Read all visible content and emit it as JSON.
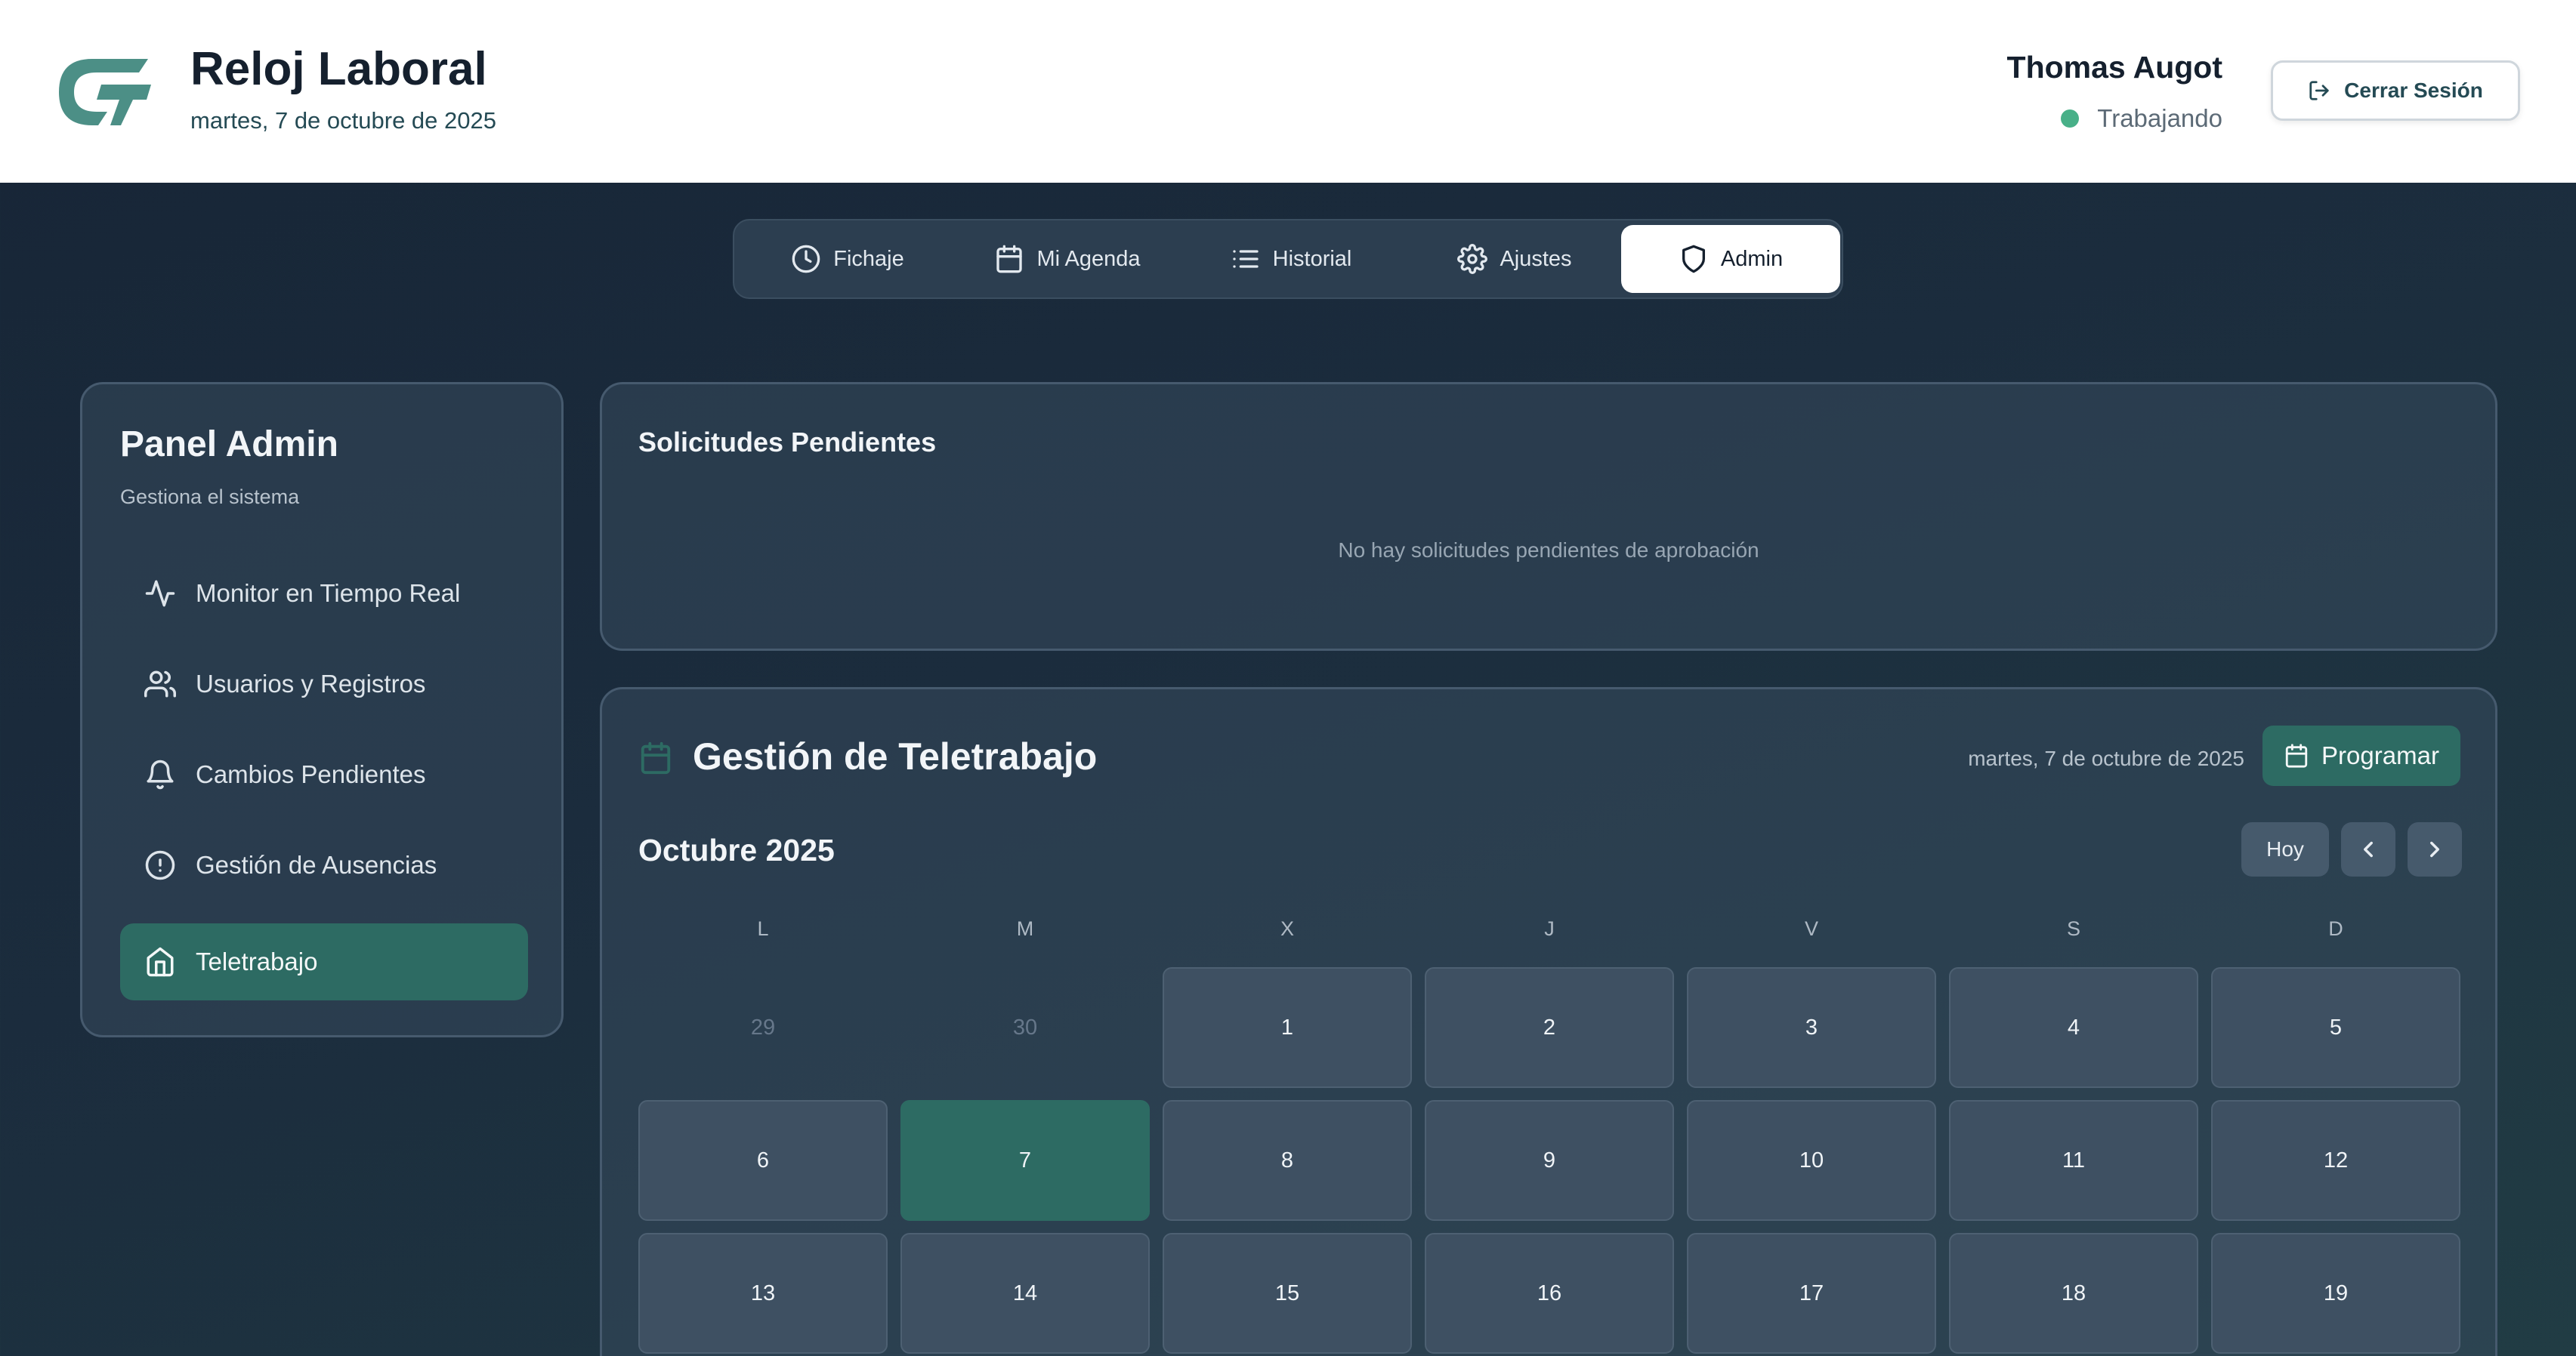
{
  "header": {
    "title": "Reloj Laboral",
    "date": "martes, 7 de octubre de 2025",
    "user_name": "Thomas Augot",
    "user_status": "Trabajando",
    "logout_label": "Cerrar Sesión"
  },
  "tabs": [
    {
      "label": "Fichaje",
      "icon": "clock-icon"
    },
    {
      "label": "Mi Agenda",
      "icon": "calendar-icon"
    },
    {
      "label": "Historial",
      "icon": "list-icon"
    },
    {
      "label": "Ajustes",
      "icon": "gear-icon"
    },
    {
      "label": "Admin",
      "icon": "shield-icon",
      "active": true
    }
  ],
  "sidebar": {
    "title": "Panel Admin",
    "subtitle": "Gestiona el sistema",
    "items": [
      {
        "label": "Monitor en Tiempo Real",
        "icon": "activity-icon"
      },
      {
        "label": "Usuarios y Registros",
        "icon": "users-icon"
      },
      {
        "label": "Cambios Pendientes",
        "icon": "bell-icon"
      },
      {
        "label": "Gestión de Ausencias",
        "icon": "alert-circle-icon"
      },
      {
        "label": "Teletrabajo",
        "icon": "home-icon",
        "active": true
      }
    ]
  },
  "requests": {
    "title": "Solicitudes Pendientes",
    "empty_message": "No hay solicitudes pendientes de aprobación"
  },
  "telework": {
    "title": "Gestión de Teletrabajo",
    "date": "martes, 7 de octubre de 2025",
    "program_label": "Programar",
    "month": "Octubre 2025",
    "today_label": "Hoy",
    "weekdays": [
      "L",
      "M",
      "X",
      "J",
      "V",
      "S",
      "D"
    ],
    "weeks": [
      [
        "29",
        "30",
        "1",
        "2",
        "3",
        "4",
        "5"
      ],
      [
        "6",
        "7",
        "8",
        "9",
        "10",
        "11",
        "12"
      ],
      [
        "13",
        "14",
        "15",
        "16",
        "17",
        "18",
        "19"
      ]
    ],
    "muted_days": [
      "29",
      "30"
    ],
    "today": "7"
  },
  "colors": {
    "accent": "#2d6b63",
    "status_green": "#48b088",
    "logo": "#4c8f86"
  }
}
